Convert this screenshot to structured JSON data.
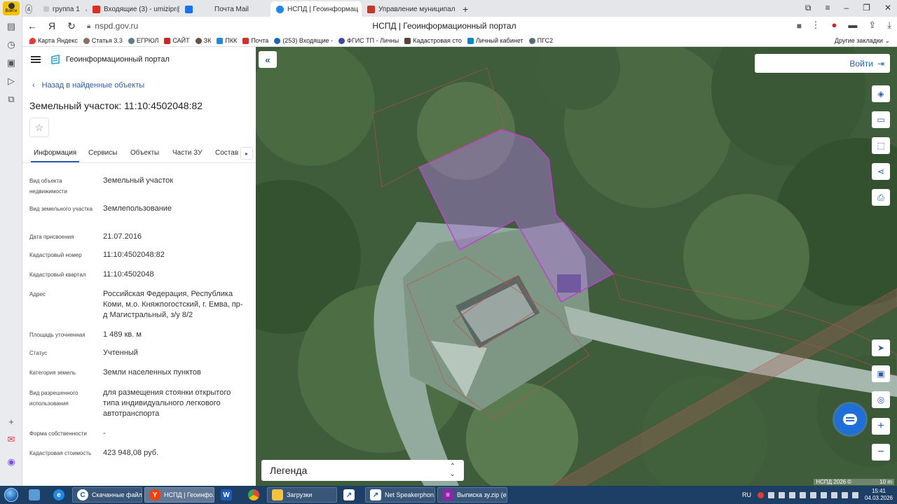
{
  "browser": {
    "avatar_label": "Войти",
    "tab_count": "4",
    "tabs": [
      {
        "label": "группа 1",
        "color": "#9aa0a6"
      },
      {
        "label": "Входящие (3) - umizipr@",
        "color": "#d93025"
      },
      {
        "label": "Почта Mail",
        "color": "#1a73e8"
      },
      {
        "label": "НСПД | Геоинформац",
        "color": "#1e88e5"
      },
      {
        "label": "Управление муниципал",
        "color": "#c0392b"
      }
    ],
    "url": "nspd.gov.ru",
    "page_title": "НСПД | Геоинформационный портал",
    "bookmarks": [
      {
        "label": "Карта Яндекс",
        "color": "#e53935"
      },
      {
        "label": "Статья 3.3",
        "color": "#8d6e63"
      },
      {
        "label": "ЕГРЮЛ",
        "color": "#607d8b"
      },
      {
        "label": "САЙТ",
        "color": "#c62828"
      },
      {
        "label": "ЗК",
        "color": "#6d4c41"
      },
      {
        "label": "ПКК",
        "color": "#1e88e5"
      },
      {
        "label": "Почта",
        "color": "#d32f2f"
      },
      {
        "label": "(253) Входящие -",
        "color": "#1565c0"
      },
      {
        "label": "ФГИС ТП - Личны",
        "color": "#3949ab"
      },
      {
        "label": "Кадастровая сто",
        "color": "#5d4037"
      },
      {
        "label": "Личный кабинет",
        "color": "#0288d1"
      },
      {
        "label": "ПГС2",
        "color": "#546e7a"
      }
    ],
    "other_bookmarks": "Другие закладки"
  },
  "panel": {
    "portal_name": "Геоинформационный портал",
    "back_label": "Назад в найденные объекты",
    "object_title": "Земельный участок: 11:10:4502048:82",
    "tabs": [
      "Информация",
      "Сервисы",
      "Объекты",
      "Части ЗУ",
      "Состав"
    ],
    "attributes": [
      {
        "key": "Вид объекта недвижимости",
        "value": "Земельный участок"
      },
      {
        "key": "Вид земельного участка",
        "value": "Землепользование"
      },
      {
        "key": "Дата присвоения",
        "value": "21.07.2016"
      },
      {
        "key": "Кадастровый номер",
        "value": "11:10:4502048:82"
      },
      {
        "key": "Кадастровый квартал",
        "value": "11:10:4502048"
      },
      {
        "key": "Адрес",
        "value": "Российская Федерация, Республика Коми, м.о. Княжпогостский, г. Емва, пр-д Магистральный, з/у 8/2"
      },
      {
        "key": "Площадь уточненная",
        "value": "1 489 кв. м"
      },
      {
        "key": "Статус",
        "value": "Учтенный"
      },
      {
        "key": "Категория земель",
        "value": "Земли населенных пунктов"
      },
      {
        "key": "Вид разрешенного использования",
        "value": "для размещения стоянки открытого типа индивидуального легкового автотранспорта"
      },
      {
        "key": "Форма собственности",
        "value": "-"
      },
      {
        "key": "Кадастровая стоимость",
        "value": "423 948,08 руб."
      }
    ]
  },
  "map": {
    "login_label": "Войти",
    "legend_label": "Легенда",
    "attribution": "НСПД 2026 ©",
    "scale_label": "10 m",
    "highlight_color": "#b07be0",
    "parcel_line_color": "#c0504d"
  },
  "taskbar": {
    "items": [
      {
        "label": "Скачанные файл...",
        "color": "#ffffff",
        "icon_text": "C"
      },
      {
        "label": "НСПД | Геоинфо...",
        "color": "#ff3d00",
        "icon_text": "Y"
      },
      {
        "label": "",
        "color": "#1e5bb8",
        "icon_text": "W"
      },
      {
        "label": "",
        "color": "#fbbc05",
        "icon_text": ""
      },
      {
        "label": "Загрузки",
        "color": "#f3c43b",
        "icon_text": ""
      },
      {
        "label": "",
        "color": "#1e5bb8",
        "icon_text": "↗"
      },
      {
        "label": "Net Speakerphon...",
        "color": "#1e5bb8",
        "icon_text": "↗"
      },
      {
        "label": "Выписка зу.zip (е...",
        "color": "#8e24aa",
        "icon_text": "≡"
      }
    ],
    "lang": "RU",
    "time": "15:41",
    "date": "04.03.2026"
  }
}
